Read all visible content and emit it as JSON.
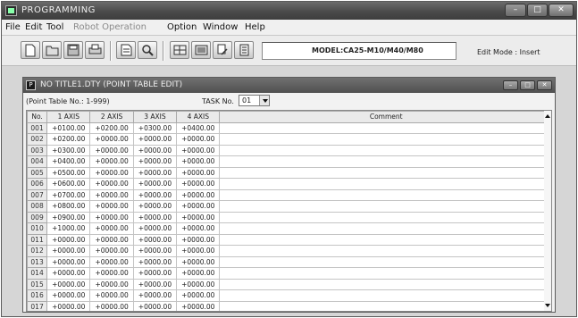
{
  "window": {
    "title": "PROGRAMMING"
  },
  "menu": [
    "File",
    "Edit",
    "Tool",
    "Robot Operation",
    "Option",
    "Window",
    "Help"
  ],
  "toolbar": {
    "model": "MODEL:CA25-M10/M40/M80",
    "edit_mode": "Edit Mode : Insert"
  },
  "child": {
    "title": "NO TITLE1.DTY (POINT TABLE EDIT)",
    "range_label": "(Point Table No.: 1-999)",
    "task_label": "TASK No.",
    "task_value": "01"
  },
  "table": {
    "headers": [
      "No.",
      "1 AXIS",
      "2 AXIS",
      "3 AXIS",
      "4 AXIS",
      "Comment"
    ],
    "rows": [
      [
        "001",
        "+0100.00",
        "+0200.00",
        "+0300.00",
        "+0400.00",
        ""
      ],
      [
        "002",
        "+0200.00",
        "+0000.00",
        "+0000.00",
        "+0000.00",
        ""
      ],
      [
        "003",
        "+0300.00",
        "+0000.00",
        "+0000.00",
        "+0000.00",
        ""
      ],
      [
        "004",
        "+0400.00",
        "+0000.00",
        "+0000.00",
        "+0000.00",
        ""
      ],
      [
        "005",
        "+0500.00",
        "+0000.00",
        "+0000.00",
        "+0000.00",
        ""
      ],
      [
        "006",
        "+0600.00",
        "+0000.00",
        "+0000.00",
        "+0000.00",
        ""
      ],
      [
        "007",
        "+0700.00",
        "+0000.00",
        "+0000.00",
        "+0000.00",
        ""
      ],
      [
        "008",
        "+0800.00",
        "+0000.00",
        "+0000.00",
        "+0000.00",
        ""
      ],
      [
        "009",
        "+0900.00",
        "+0000.00",
        "+0000.00",
        "+0000.00",
        ""
      ],
      [
        "010",
        "+1000.00",
        "+0000.00",
        "+0000.00",
        "+0000.00",
        ""
      ],
      [
        "011",
        "+0000.00",
        "+0000.00",
        "+0000.00",
        "+0000.00",
        ""
      ],
      [
        "012",
        "+0000.00",
        "+0000.00",
        "+0000.00",
        "+0000.00",
        ""
      ],
      [
        "013",
        "+0000.00",
        "+0000.00",
        "+0000.00",
        "+0000.00",
        ""
      ],
      [
        "014",
        "+0000.00",
        "+0000.00",
        "+0000.00",
        "+0000.00",
        ""
      ],
      [
        "015",
        "+0000.00",
        "+0000.00",
        "+0000.00",
        "+0000.00",
        ""
      ],
      [
        "016",
        "+0000.00",
        "+0000.00",
        "+0000.00",
        "+0000.00",
        ""
      ],
      [
        "017",
        "+0000.00",
        "+0000.00",
        "+0000.00",
        "+0000.00",
        ""
      ]
    ]
  },
  "colors": {
    "title_bar": "#4a4a4a",
    "grid_header": "#eaeaea"
  }
}
